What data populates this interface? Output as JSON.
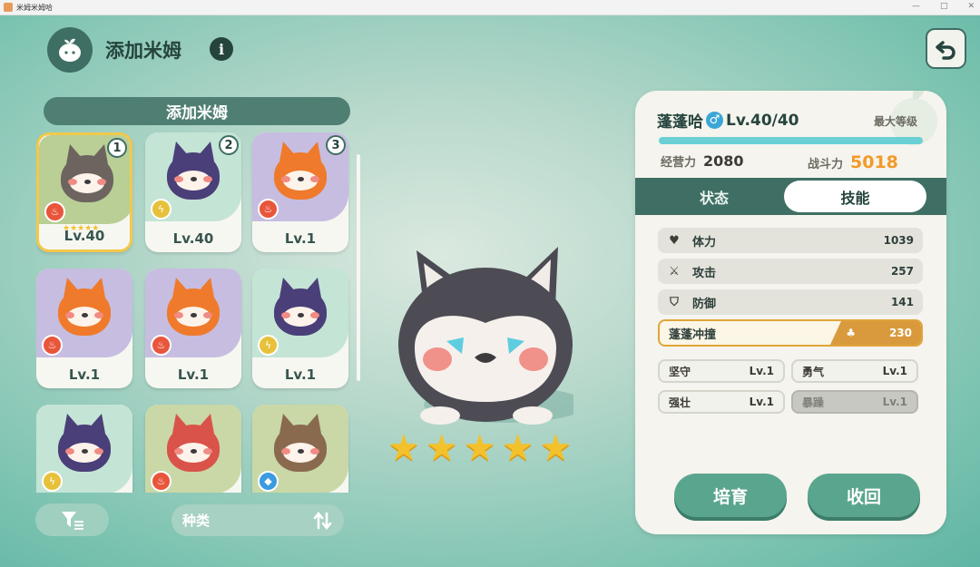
{
  "window": {
    "title": "米姆米姆哈",
    "controls": [
      "—",
      "□",
      "✕"
    ]
  },
  "header": {
    "title": "添加米姆",
    "info_glyph": "i",
    "logo_icon": "sprout-head-icon",
    "back_icon": "back-arrow-icon"
  },
  "list": {
    "title": "添加米姆",
    "cards": [
      {
        "num": "1",
        "level": "Lv.40",
        "element": "fire",
        "stars": "★★★★★",
        "bg": "#b9cf96",
        "body": "#6d6460",
        "selected": true
      },
      {
        "num": "2",
        "level": "Lv.40",
        "element": "electric",
        "stars": "",
        "bg": "#c4e4d6",
        "body": "#4a3f78",
        "selected": false
      },
      {
        "num": "3",
        "level": "Lv.1",
        "element": "fire",
        "stars": "",
        "bg": "#c7bde0",
        "body": "#ef7a2c",
        "selected": false
      },
      {
        "num": "",
        "level": "Lv.1",
        "element": "fire",
        "stars": "",
        "bg": "#c7bde0",
        "body": "#ef7a2c",
        "selected": false
      },
      {
        "num": "",
        "level": "Lv.1",
        "element": "fire",
        "stars": "",
        "bg": "#c7bde0",
        "body": "#ef7a2c",
        "selected": false
      },
      {
        "num": "",
        "level": "Lv.1",
        "element": "electric",
        "stars": "",
        "bg": "#c4e4d6",
        "body": "#4a3f78",
        "selected": false
      },
      {
        "num": "",
        "level": "",
        "element": "electric",
        "stars": "",
        "bg": "#c4e4d6",
        "body": "#4a3f78",
        "selected": false
      },
      {
        "num": "",
        "level": "",
        "element": "fire",
        "stars": "",
        "bg": "#c9d8a6",
        "body": "#d9534a",
        "selected": false
      },
      {
        "num": "",
        "level": "",
        "element": "water",
        "stars": "",
        "bg": "#c9d8a6",
        "body": "#8a6a4f",
        "selected": false
      }
    ]
  },
  "bottom": {
    "filter_icon": "filter-icon",
    "sort_label": "种类",
    "sort_icon": "sort-arrows-icon"
  },
  "showcase": {
    "stars": [
      "★",
      "★",
      "★",
      "★",
      "★"
    ]
  },
  "panel": {
    "name": "蓬蓬哈",
    "gender": "♂",
    "level": "Lv.40/40",
    "max_label": "最大等级",
    "xp_fraction": 1.0,
    "stat1_label": "经营力",
    "stat1_value": "2080",
    "stat2_label": "战斗力",
    "stat2_value": "5018",
    "tabs": {
      "status": "状态",
      "skills": "技能",
      "active": "skills"
    },
    "attributes": [
      {
        "icon": "heart-icon",
        "glyph": "♥",
        "label": "体力",
        "value": "1039"
      },
      {
        "icon": "sword-icon",
        "glyph": "⚔",
        "label": "攻击",
        "value": "257"
      },
      {
        "icon": "shield-icon",
        "glyph": "⛉",
        "label": "防御",
        "value": "141"
      }
    ],
    "skill": {
      "label": "蓬蓬冲撞",
      "value": "230",
      "icon": "skill-leaf-icon"
    },
    "traits": [
      {
        "label": "坚守",
        "level": "Lv.1",
        "dim": false
      },
      {
        "label": "勇气",
        "level": "Lv.1",
        "dim": false
      },
      {
        "label": "强壮",
        "level": "Lv.1",
        "dim": false
      },
      {
        "label": "暴躁",
        "level": "Lv.1",
        "dim": true
      }
    ],
    "buttons": {
      "train": "培育",
      "recall": "收回"
    }
  },
  "colors": {
    "accent": "#3f6f64",
    "gold": "#f3c12b",
    "orange": "#f39a28",
    "fire": "#e8553a",
    "electric": "#e8c13b",
    "water": "#3b9be0"
  }
}
